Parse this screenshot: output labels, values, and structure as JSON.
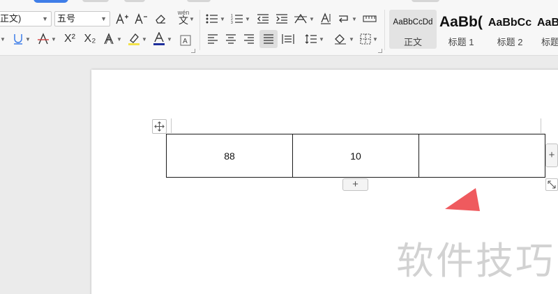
{
  "ribbon": {
    "font_name": "正文)",
    "font_size": "五号",
    "pinyin_label": "wén",
    "pinyin_char": "文",
    "superscript_label": "X²",
    "subscript_label": "X₂",
    "styles": [
      {
        "sample": "AaBbCcDd",
        "name": "正文"
      },
      {
        "sample": "AaBb(",
        "name": "标题 1"
      },
      {
        "sample": "AaBbCc",
        "name": "标题 2"
      },
      {
        "sample": "AaB",
        "name": "标题"
      }
    ]
  },
  "table": {
    "rows": [
      [
        "88",
        "10",
        ""
      ]
    ]
  },
  "controls": {
    "add_row": "+",
    "add_col": "+"
  },
  "watermark": "软件技巧",
  "colors": {
    "accent": "#3f7ee8",
    "highlight": "#f2e24a",
    "font_color": "#1e2f9c",
    "pointer": "#ef5a5e"
  },
  "icons": {
    "move": "move-icon",
    "resize": "resize-icon",
    "pointer": "pointer-arrow-icon"
  }
}
